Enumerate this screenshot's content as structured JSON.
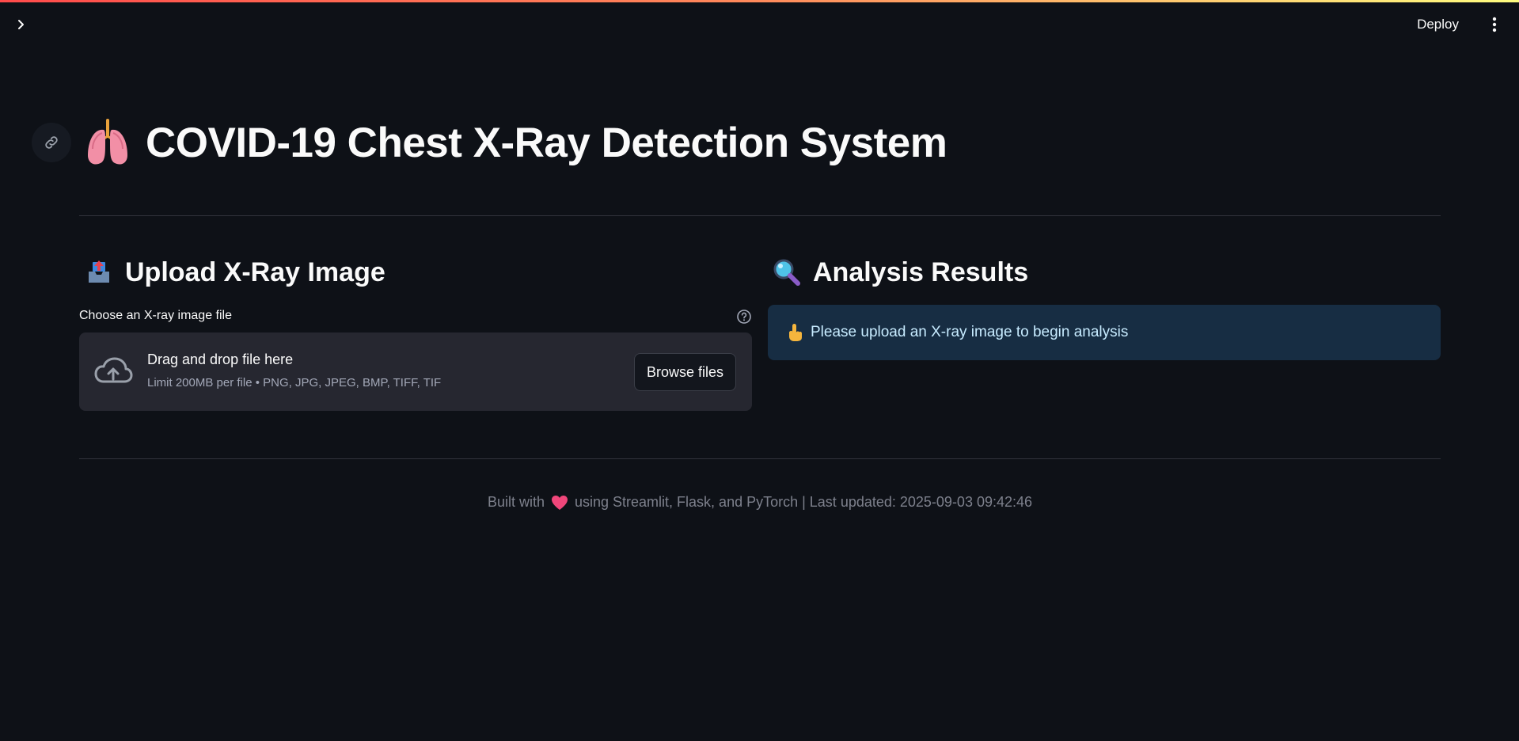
{
  "header": {
    "deploy_label": "Deploy",
    "sidebar_toggle_icon": "chevron-right-icon",
    "menu_icon": "more-vertical-icon",
    "stripe_colors": [
      "#ff4b4b",
      "#fffd80"
    ]
  },
  "page": {
    "title": "COVID-19 Chest X-Ray Detection System",
    "title_icon": "lungs-icon",
    "anchor_icon": "link-icon"
  },
  "upload": {
    "heading": "Upload X-Ray Image",
    "heading_icon": "outbox-tray-icon",
    "label": "Choose an X-ray image file",
    "help_icon": "question-circle-icon",
    "dropzone_title": "Drag and drop file here",
    "dropzone_limit": "Limit 200MB per file • PNG, JPG, JPEG, BMP, TIFF, TIF",
    "browse_label": "Browse files",
    "cloud_icon": "cloud-upload-icon"
  },
  "results": {
    "heading": "Analysis Results",
    "heading_icon": "magnifier-icon",
    "info_text": "Please upload an X-ray image to begin analysis",
    "info_icon": "pointing-hand-icon"
  },
  "footer": {
    "prefix": "Built with",
    "suffix": "using Streamlit, Flask, and PyTorch | Last updated: 2025-09-03 09:42:46",
    "heart_icon": "heart-icon"
  },
  "colors": {
    "background": "#0e1117",
    "dropzone_bg": "#262730",
    "info_bg": "#172d43",
    "info_text": "#c7ebff",
    "footer_text": "#7d808c"
  }
}
